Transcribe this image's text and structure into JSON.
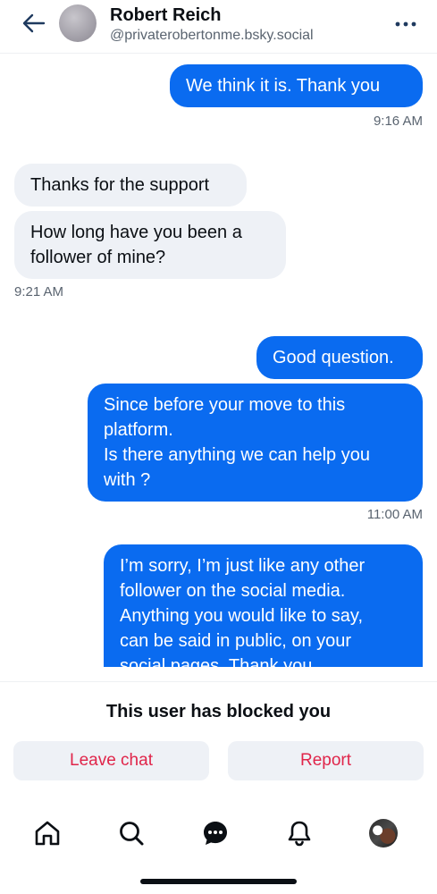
{
  "header": {
    "name": "Robert Reich",
    "handle": "@privaterobertonme.bsky.social"
  },
  "messages": {
    "m1": "We think it is.  Thank you",
    "t1": "9:16 AM",
    "m2": "Thanks for the support",
    "m3_line1": "How long have you been a",
    "m3_line2": "follower of mine?",
    "t2": "9:21 AM",
    "m4": "Good question.",
    "m5_line1": "Since before your move to this",
    "m5_line2": "platform.",
    "m5_line3": "Is there anything we can help you",
    "m5_line4": "with ?",
    "t3": "11:00 AM",
    "m6_line1": "I’m sorry, I’m just like any other",
    "m6_line2": "follower  on the social media.",
    "m6_line3": "Anything you would like to say,",
    "m6_line4": "can be said in public, on your",
    "m6_line5": "social pages.  Thank you."
  },
  "blocked": {
    "text": "This user has blocked you",
    "leave_label": "Leave chat",
    "report_label": "Report"
  },
  "colors": {
    "accent": "#0a6bf0",
    "danger": "#e0254a",
    "bubble_in": "#eef1f6"
  },
  "icons": {
    "back": "arrow-left-icon",
    "more": "ellipsis-icon",
    "home": "home-icon",
    "search": "search-icon",
    "chat": "chat-icon",
    "notifications": "bell-icon"
  }
}
